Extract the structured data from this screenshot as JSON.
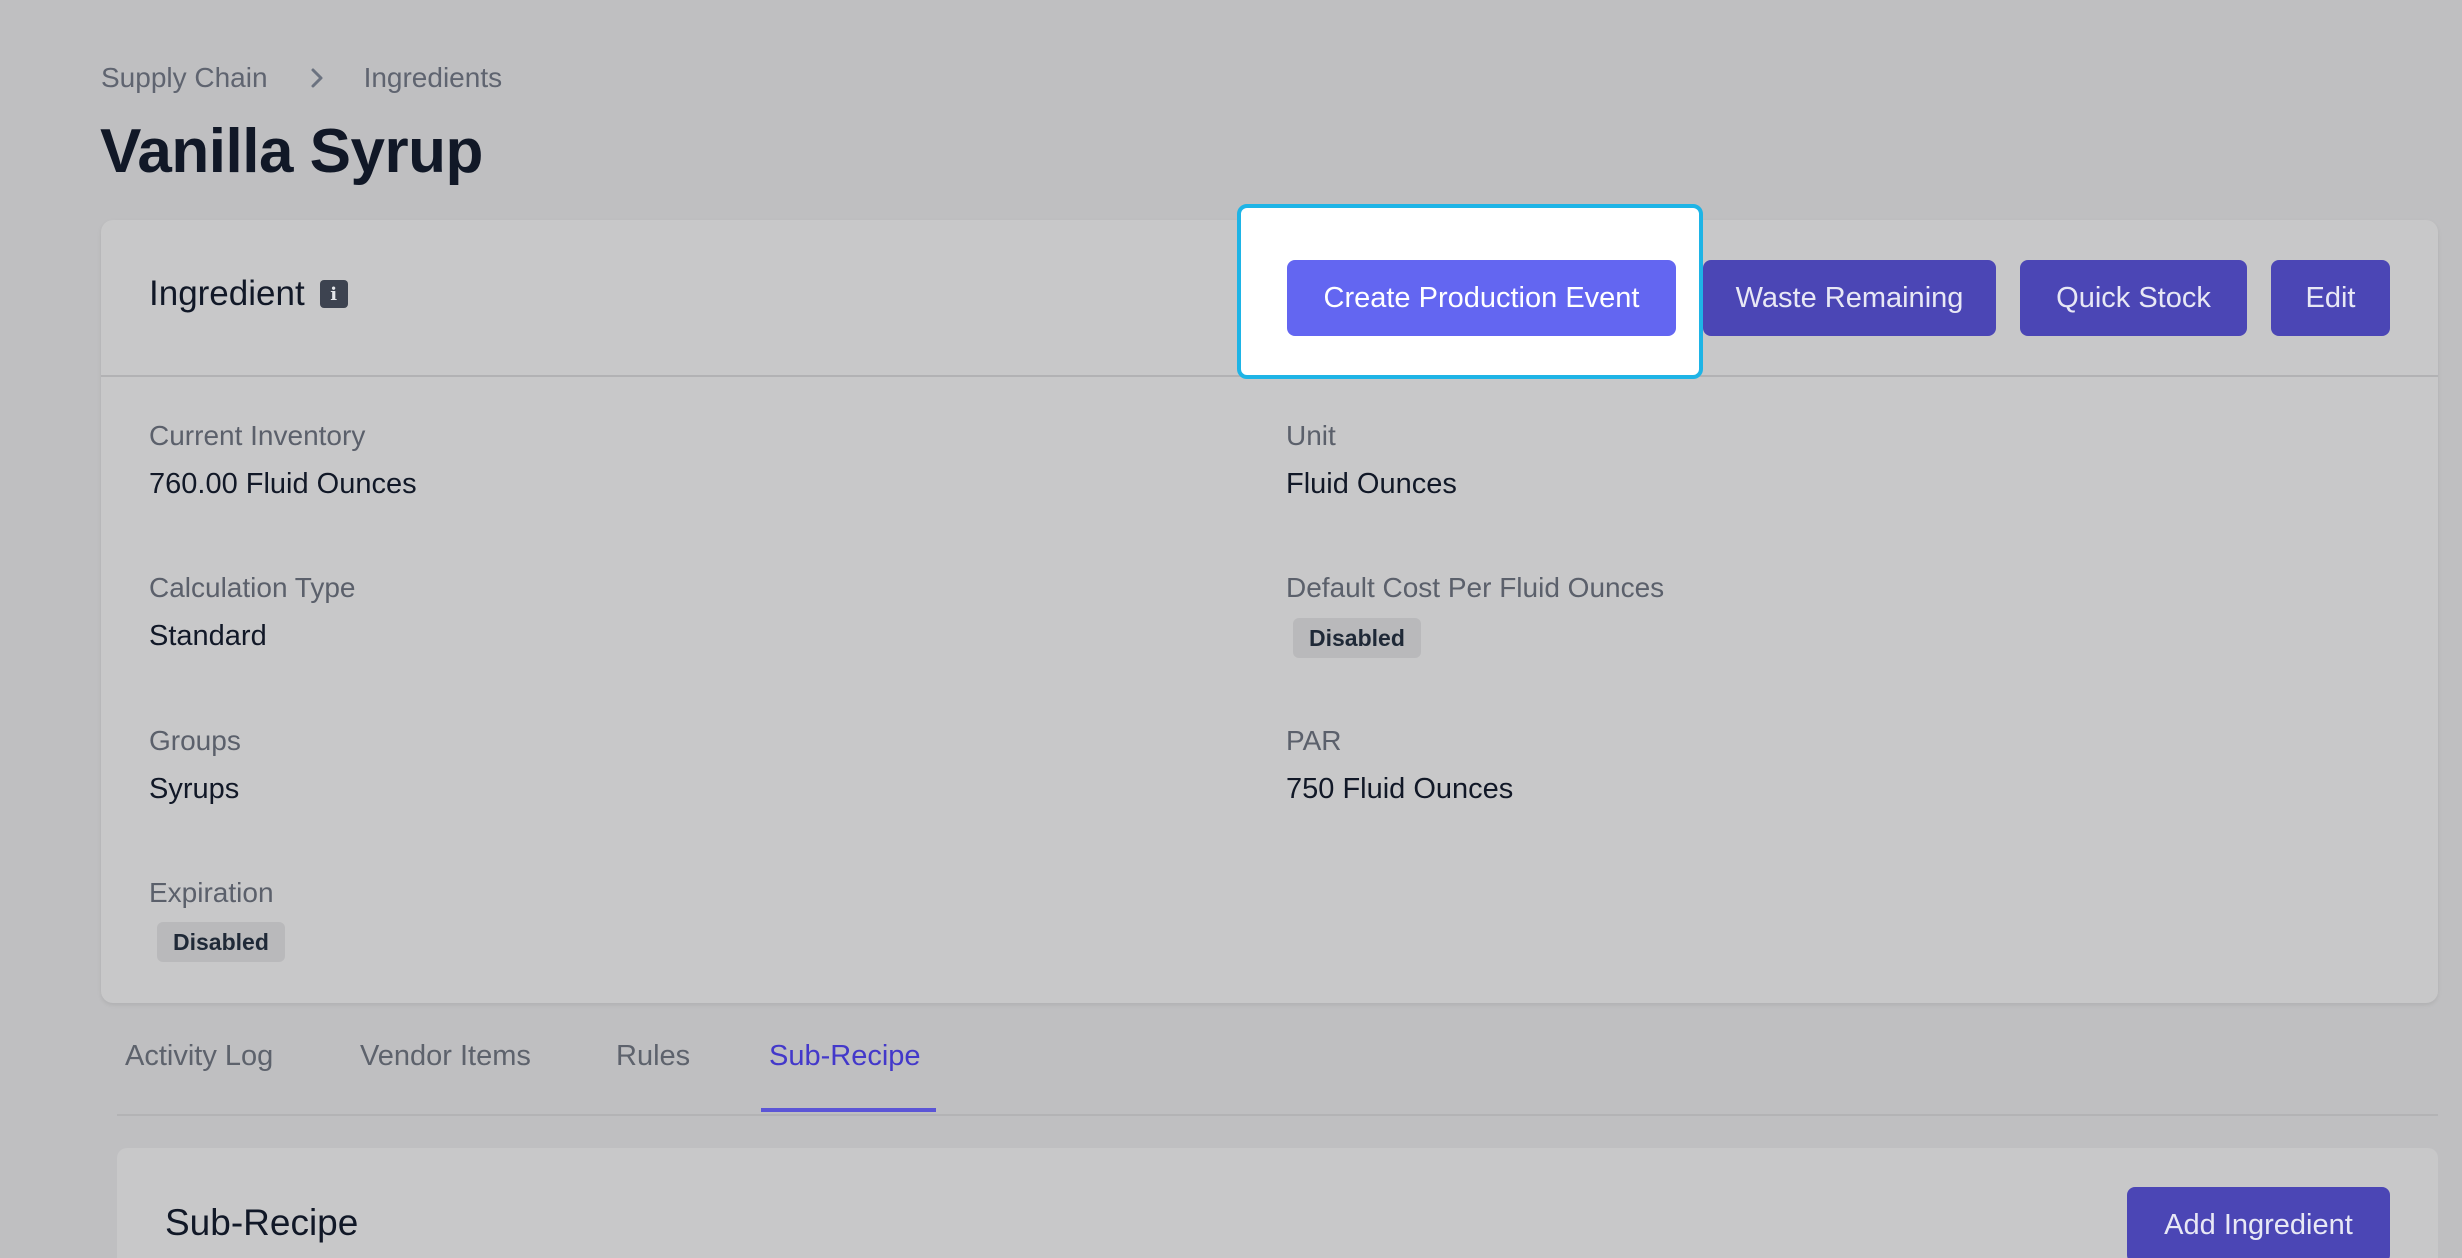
{
  "breadcrumb": {
    "items": [
      "Supply Chain",
      "Ingredients"
    ],
    "separator_icon": "chevron-right-icon"
  },
  "page": {
    "title": "Vanilla Syrup"
  },
  "card": {
    "title": "Ingredient",
    "info_icon": "info-icon",
    "info_glyph": "i",
    "actions": {
      "create_production_event": "Create Production Event",
      "waste_remaining": "Waste Remaining",
      "quick_stock": "Quick Stock",
      "edit": "Edit"
    },
    "fields": {
      "current_inventory": {
        "label": "Current Inventory",
        "value": "760.00 Fluid Ounces"
      },
      "unit": {
        "label": "Unit",
        "value": "Fluid Ounces"
      },
      "calculation_type": {
        "label": "Calculation Type",
        "value": "Standard"
      },
      "default_cost": {
        "label": "Default Cost Per Fluid Ounces",
        "badge": "Disabled"
      },
      "groups": {
        "label": "Groups",
        "value": "Syrups"
      },
      "par": {
        "label": "PAR",
        "value": "750 Fluid Ounces"
      },
      "expiration": {
        "label": "Expiration",
        "badge": "Disabled"
      }
    }
  },
  "tabs": {
    "items": [
      "Activity Log",
      "Vendor Items",
      "Rules",
      "Sub-Recipe"
    ],
    "active": "Sub-Recipe"
  },
  "subrecipe": {
    "title": "Sub-Recipe",
    "add_label": "Add Ingredient"
  },
  "colors": {
    "accent": "#6366f1",
    "button": "#4b46b5",
    "highlight_border": "#1eb4e6",
    "active_tab": "#4338ca"
  }
}
